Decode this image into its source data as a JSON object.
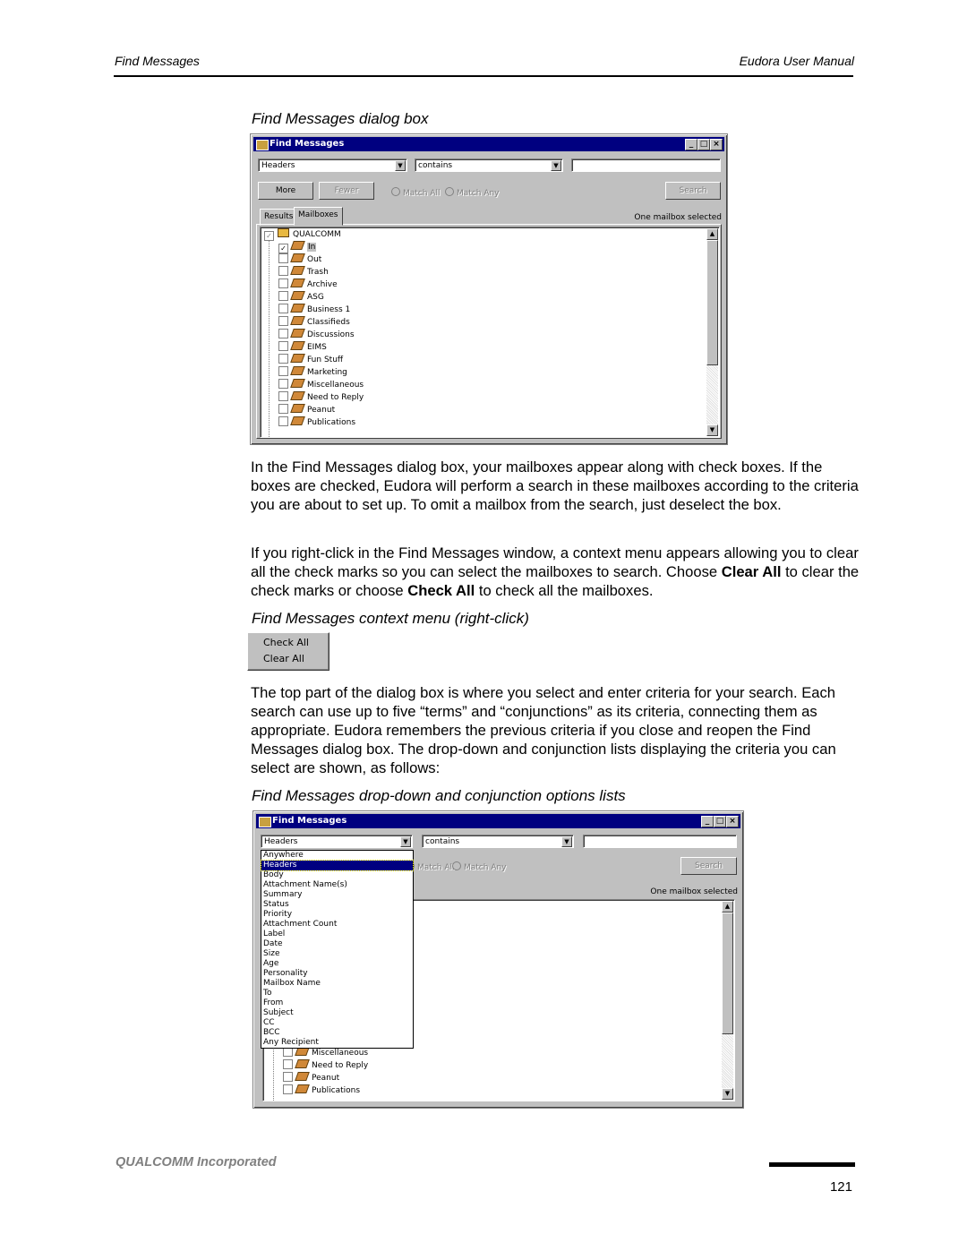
{
  "header": {
    "left": "Find Messages",
    "right": "Eudora User Manual"
  },
  "captions": [
    "Find Messages dialog box",
    "Find Messages context menu (right-click)",
    "Find Messages drop-down and conjunction options lists"
  ],
  "dialog1": {
    "title": "Find Messages",
    "field_value": "Headers",
    "condition_value": "contains",
    "search_text": "",
    "more": "More",
    "fewer": "Fewer",
    "match_all": "Match All",
    "match_any": "Match Any",
    "search": "Search",
    "tabs": [
      "Results",
      "Mailboxes"
    ],
    "status": "One mailbox selected",
    "root": "QUALCOMM",
    "mailboxes": [
      {
        "label": "In",
        "checked": true,
        "icon": "in-mailbox-icon"
      },
      {
        "label": "Out",
        "checked": false,
        "icon": "out-mailbox-icon"
      },
      {
        "label": "Trash",
        "checked": false,
        "icon": "trash-icon"
      },
      {
        "label": "Archive",
        "checked": false,
        "icon": "mailbox-icon"
      },
      {
        "label": "ASG",
        "checked": false,
        "icon": "mailbox-icon"
      },
      {
        "label": "Business 1",
        "checked": false,
        "icon": "mailbox-icon"
      },
      {
        "label": "Classifieds",
        "checked": false,
        "icon": "mailbox-icon"
      },
      {
        "label": "Discussions",
        "checked": false,
        "icon": "mailbox-icon"
      },
      {
        "label": "EIMS",
        "checked": false,
        "icon": "mailbox-icon"
      },
      {
        "label": "Fun Stuff",
        "checked": false,
        "icon": "mailbox-icon"
      },
      {
        "label": "Marketing",
        "checked": false,
        "icon": "mailbox-icon"
      },
      {
        "label": "Miscellaneous",
        "checked": false,
        "icon": "mailbox-icon"
      },
      {
        "label": "Need to Reply",
        "checked": false,
        "icon": "mailbox-icon"
      },
      {
        "label": "Peanut",
        "checked": false,
        "icon": "mailbox-icon"
      },
      {
        "label": "Publications",
        "checked": false,
        "icon": "mailbox-icon"
      }
    ]
  },
  "paragraphs": [
    "In the Find Messages dialog box, your mailboxes appear along with check boxes. If the boxes are checked, Eudora will perform a search in these mailboxes according to the criteria you are about to set up. To omit a mailbox from the search, just deselect the box.",
    {
      "a": "If you right-click in the Find Messages window, a context menu appears allowing you to clear all the check marks so you can select the mailboxes to search. Choose ",
      "b1": "Clear All",
      "c": " to clear the check marks or choose ",
      "b2": "Check All",
      "d": " to check all the mailboxes."
    },
    "The top part of the dialog box is where you select and enter criteria for your search. Each search can use up to five “terms” and “conjunctions” as its criteria, connecting them as appropriate. Eudora remembers the previous criteria if you close and reopen the Find Messages dialog box. The drop-down and conjunction lists displaying the criteria you can select are shown, as follows:"
  ],
  "context_menu": [
    "Check All",
    "Clear All"
  ],
  "dialog2": {
    "title": "Find Messages",
    "field_value": "Headers",
    "condition_value": "contains",
    "match_all": "Match All",
    "match_any": "Match Any",
    "search": "Search",
    "status": "One mailbox selected",
    "options": [
      "Anywhere",
      "Headers",
      "Body",
      "Attachment Name(s)",
      "Summary",
      "Status",
      "Priority",
      "Attachment Count",
      "Label",
      "Date",
      "Size",
      "Age",
      "Personality",
      "Mailbox Name",
      "To",
      "From",
      "Subject",
      "CC",
      "BCC",
      "Any Recipient"
    ],
    "selected_option": "Headers",
    "mailboxes": [
      "Miscellaneous",
      "Need to Reply",
      "Peanut",
      "Publications"
    ]
  },
  "footer": {
    "company": "QUALCOMM Incorporated",
    "page": "121"
  }
}
